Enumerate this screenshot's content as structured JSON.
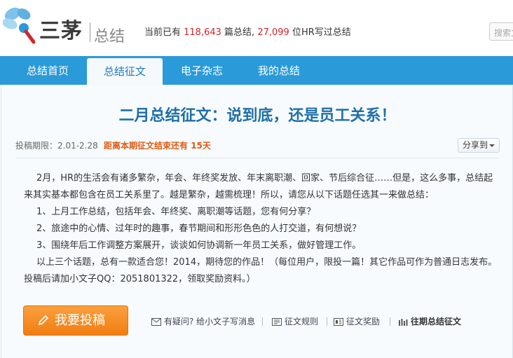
{
  "header": {
    "logo_text": "三茅",
    "logo_sub": "总结",
    "stats_prefix": "当前已有 ",
    "summary_count": "118,643",
    "stats_middle": " 篇总结, ",
    "hr_count": "27,099",
    "stats_suffix": " 位HR写过总结",
    "search_placeholder": "搜索文"
  },
  "nav": {
    "items": [
      {
        "label": "总结首页"
      },
      {
        "label": "总结征文"
      },
      {
        "label": "电子杂志"
      },
      {
        "label": "我的总结"
      }
    ],
    "active_index": 1
  },
  "article": {
    "title": "二月总结征文：说到底，还是员工关系！",
    "deadline": "投稿期限：2.01-2.28",
    "countdown_prefix": "距离本期征文结束还有 ",
    "countdown_days": "15天",
    "share_label": "分享到",
    "paragraph_1": "2月，HR的生活会有诸多繁杂，年会、年终奖发放、年末离职潮、回家、节后综合征……但是，这么多事，总结起来其实基本都包含在员工关系里了。越是繁杂，越需梳理！所以，请您从以下话题任选其一来做总结：",
    "topics": [
      "1、上月工作总结，包括年会、年终奖、离职潮等话题，您有何分享？",
      "2、旅途中的心情、过年时的趣事，春节期间和形形色色的人打交道，有何想说？",
      "3、围绕年后工作调整方案展开，谈谈如何协调新一年员工关系，做好管理工作。"
    ],
    "paragraph_2": "以上三个话题，总有一款适合您！2014，期待您的作品！（每位用户，限投一篇！其它作品可作为普通日志发布。投稿后请加小文子QQ：2051801322，领取奖励资料。）"
  },
  "actions": {
    "submit_label": "我要投稿",
    "links": [
      {
        "label": "有疑问? 给小文子写消息",
        "icon": "envelope-icon"
      },
      {
        "label": "征文规则",
        "icon": "rules-icon"
      },
      {
        "label": "征文奖励",
        "icon": "reward-icon"
      },
      {
        "label": "往期总结征文",
        "icon": "archive-icon"
      }
    ]
  },
  "colors": {
    "nav_blue": "#2b9ad8",
    "title_blue": "#1f6fa8",
    "accent_red": "#d0262c",
    "button_orange": "#f07d10"
  }
}
